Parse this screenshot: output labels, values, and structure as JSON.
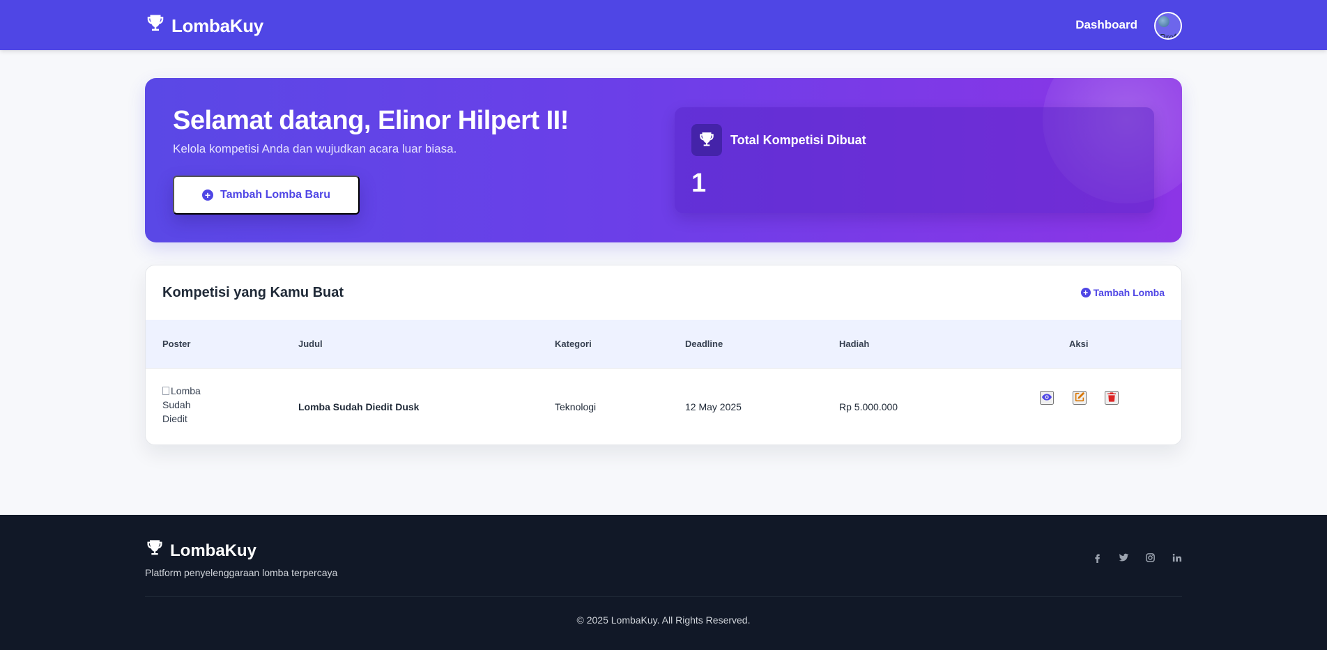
{
  "navbar": {
    "brand": "LombaKuy",
    "dashboard_link": "Dashboard",
    "avatar_alt": "Prof"
  },
  "hero": {
    "title": "Selamat datang, Elinor Hilpert II!",
    "subtitle": "Kelola kompetisi Anda dan wujudkan acara luar biasa.",
    "add_button": "Tambah Lomba Baru",
    "stat_label": "Total Kompetisi Dibuat",
    "stat_value": "1"
  },
  "competitions": {
    "title": "Kompetisi yang Kamu Buat",
    "add_link": "Tambah Lomba",
    "columns": [
      "Poster",
      "Judul",
      "Kategori",
      "Deadline",
      "Hadiah",
      "Aksi"
    ],
    "rows": [
      {
        "poster_alt": "Lomba Sudah Diedit",
        "judul": "Lomba Sudah Diedit Dusk",
        "kategori": "Teknologi",
        "deadline": "12 May 2025",
        "hadiah": "Rp 5.000.000",
        "actions": [
          "eye-icon",
          "edit-icon",
          "trash-icon"
        ]
      }
    ]
  },
  "footer": {
    "brand": "LombaKuy",
    "tagline": "Platform penyelenggaraan lomba terpercaya",
    "socials": [
      "facebook-icon",
      "twitter-icon",
      "instagram-icon",
      "linkedin-icon"
    ],
    "copyright": "© 2025 LombaKuy. All Rights Reserved."
  },
  "colors": {
    "primary": "#4f46e5",
    "accent_purple": "#8c35e6",
    "edit": "#d97706",
    "delete": "#dc2626",
    "footer_bg": "#111827"
  }
}
